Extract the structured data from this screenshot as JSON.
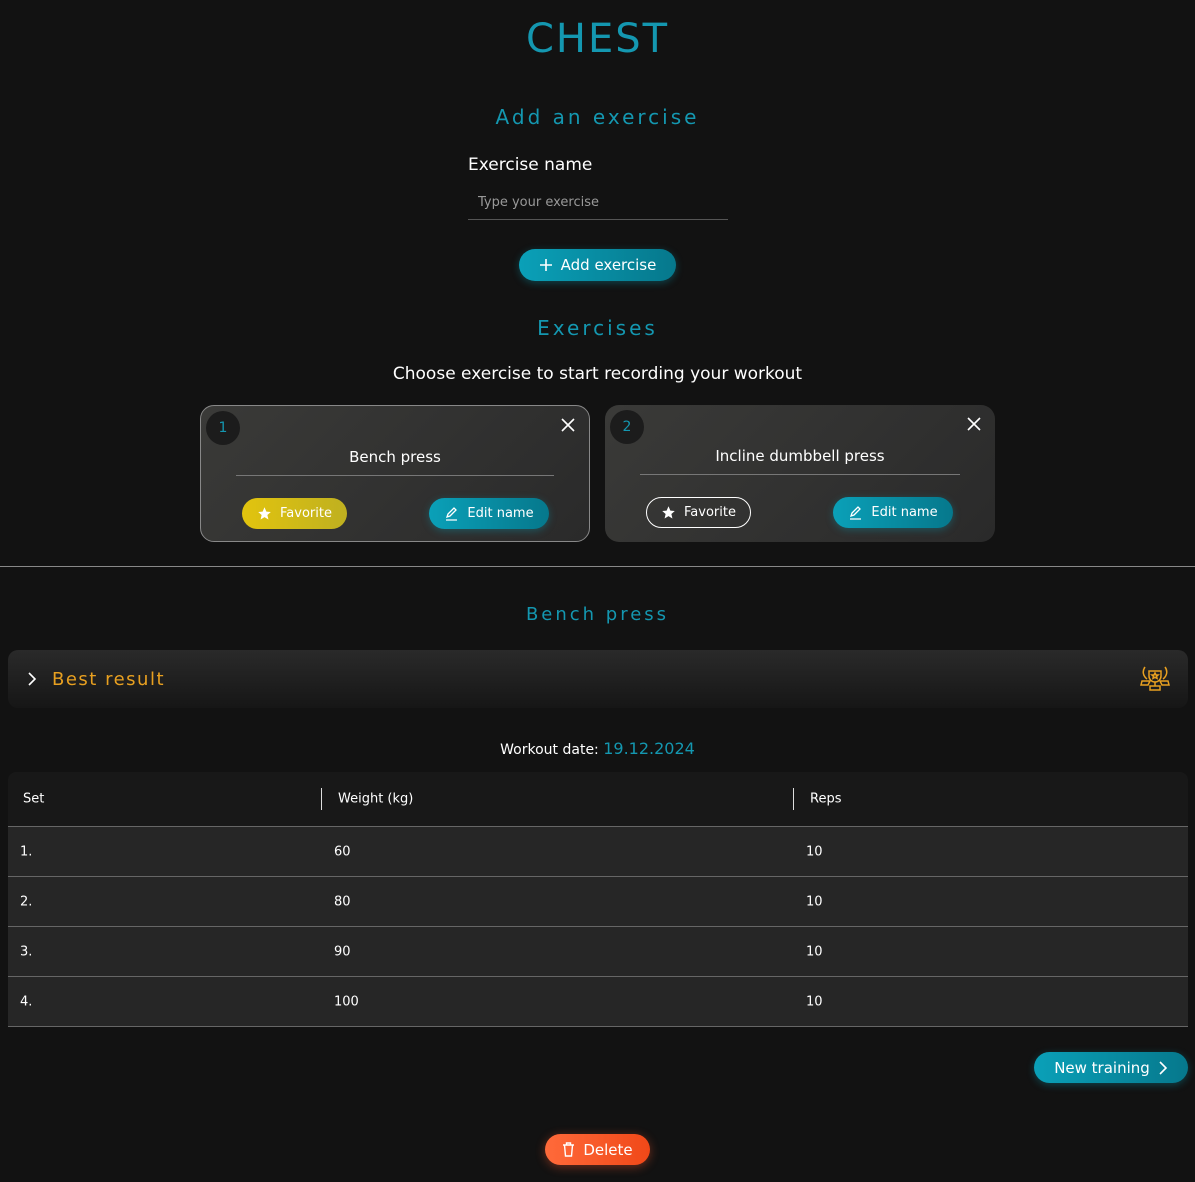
{
  "page_title": "CHEST",
  "add_section": {
    "heading": "Add an exercise",
    "field_label": "Exercise name",
    "placeholder": "Type your exercise",
    "value": "",
    "button": "Add exercise"
  },
  "exercises": {
    "heading": "Exercises",
    "subtitle": "Choose exercise to start recording your workout",
    "cards": [
      {
        "number": "1",
        "name": "Bench press",
        "favorite": "Favorite",
        "edit": "Edit name",
        "is_favorite": true,
        "selected": true
      },
      {
        "number": "2",
        "name": "Incline dumbbell press",
        "favorite": "Favorite",
        "edit": "Edit name",
        "is_favorite": false,
        "selected": false
      }
    ]
  },
  "detail": {
    "heading": "Bench press",
    "best_result": "Best result",
    "date_label": "Workout date:",
    "date_value": "19.12.2024"
  },
  "table": {
    "headers": [
      "Set",
      "Weight (kg)",
      "Reps"
    ],
    "rows": [
      [
        "1.",
        "60",
        "10"
      ],
      [
        "2.",
        "80",
        "10"
      ],
      [
        "3.",
        "90",
        "10"
      ],
      [
        "4.",
        "100",
        "10"
      ]
    ]
  },
  "buttons": {
    "new_training": "New training",
    "delete": "Delete"
  },
  "colors": {
    "accent": "#1497b0",
    "favorite": "#d8c012",
    "best": "#e8a020",
    "delete": "#ff5a30"
  }
}
